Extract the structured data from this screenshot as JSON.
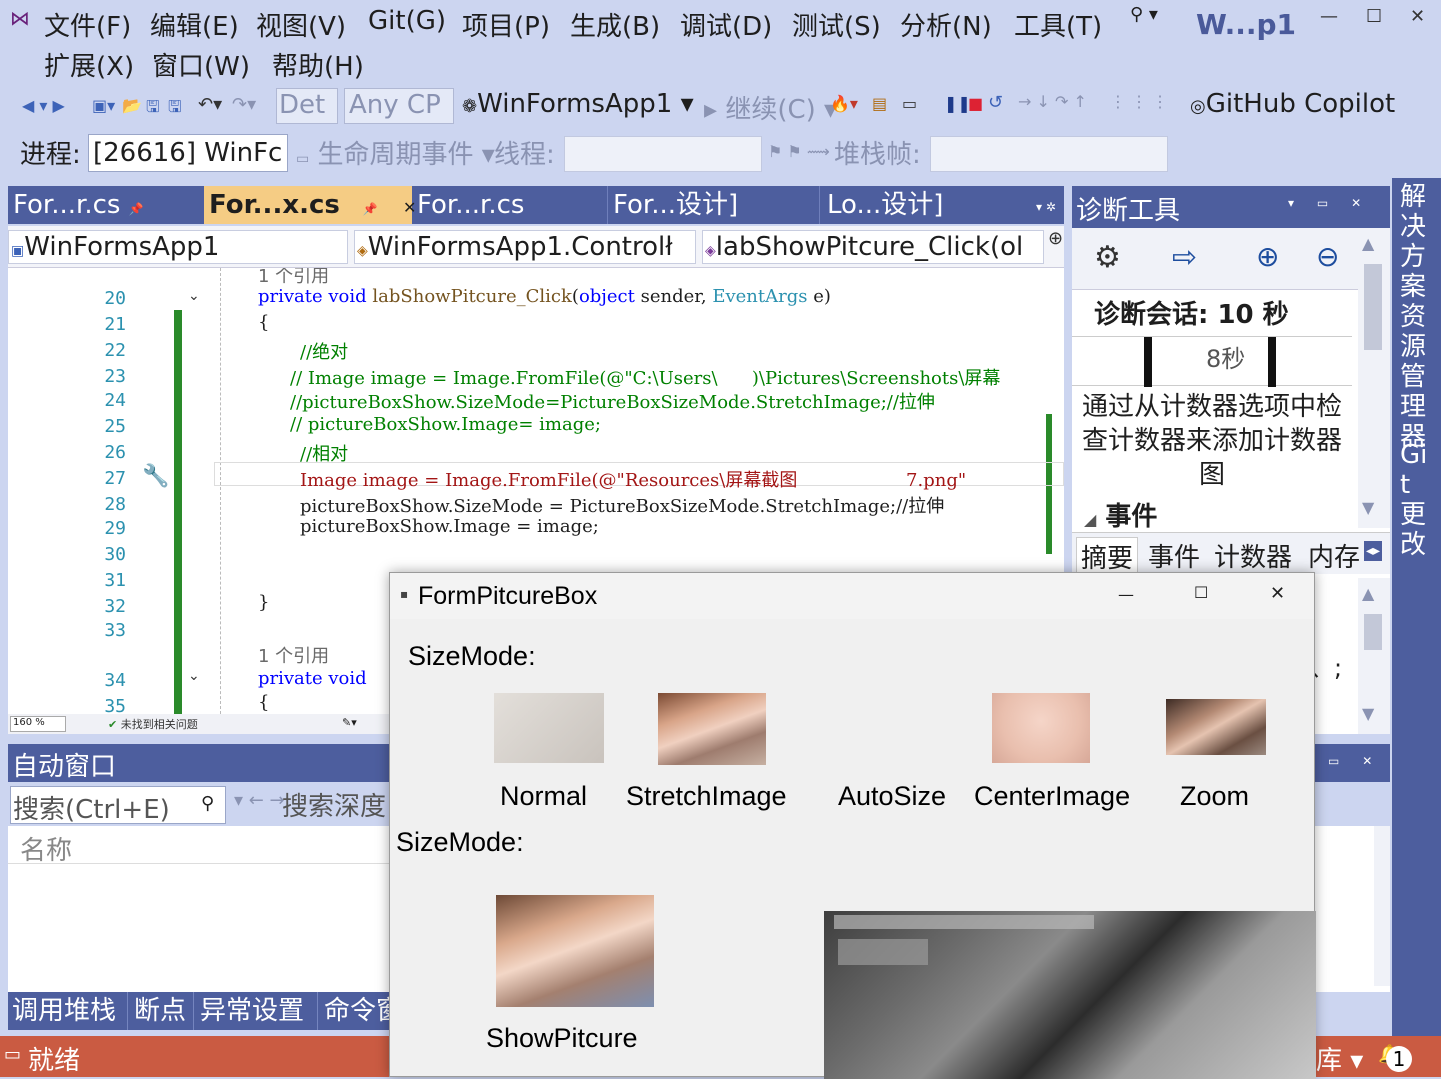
{
  "menu": {
    "items": [
      "文件(F)",
      "编辑(E)",
      "视图(V)",
      "Git(G)",
      "项目(P)",
      "生成(B)",
      "调试(D)",
      "测试(S)",
      "分析(N)",
      "工具(T)"
    ],
    "row2": [
      "扩展(X)",
      "窗口(W)",
      "帮助(H)"
    ],
    "window_title": "W...p1"
  },
  "toolbar": {
    "config": "Det",
    "platform": "Any CP",
    "startup_project": "WinFormsApp1",
    "continue": "继续(C)",
    "copilot": "GitHub Copilot"
  },
  "process": {
    "label": "进程:",
    "value": "[26616] WinFc",
    "lifecycle": "生命周期事件",
    "thread_label": "线程:",
    "stack_label": "堆栈帧:"
  },
  "doc_tabs": [
    {
      "label": "For...r.cs",
      "active": false
    },
    {
      "label": "For...x.cs",
      "active": true
    },
    {
      "label": "For...r.cs",
      "active": false
    },
    {
      "label": "For...设计]",
      "active": false
    },
    {
      "label": "Lo...设计]",
      "active": false
    }
  ],
  "navbar": {
    "project": "WinFormsApp1",
    "class": "WinFormsApp1.Controlł",
    "member": "labShowPitcure_Click(ol"
  },
  "editor": {
    "ref_count_top": "1 个引用",
    "ref_count_2": "1 个引用",
    "zoom": "160 %",
    "issues": "未找到相关问题",
    "lines": [
      {
        "n": "20",
        "html": "private void labShowPitcure_Click(object sender, EventArgs e)"
      },
      {
        "n": "21",
        "text": "{"
      },
      {
        "n": "22",
        "text": "//绝对"
      },
      {
        "n": "23",
        "text": "// Image image = Image.FromFile(@\"C:\\Users\\      )\\Pictures\\Screenshots\\屏幕"
      },
      {
        "n": "24",
        "text": "//pictureBoxShow.SizeMode=PictureBoxSizeMode.StretchImage;//拉伸"
      },
      {
        "n": "25",
        "text": "// pictureBoxShow.Image= image;"
      },
      {
        "n": "26",
        "text": "//相对"
      },
      {
        "n": "27",
        "text": "Image image = Image.FromFile(@\"Resources\\屏幕截图                   7.png\""
      },
      {
        "n": "28",
        "text": "pictureBoxShow.SizeMode = PictureBoxSizeMode.StretchImage;//拉伸"
      },
      {
        "n": "29",
        "text": "pictureBoxShow.Image = image;"
      },
      {
        "n": "30",
        "text": ""
      },
      {
        "n": "31",
        "text": ""
      },
      {
        "n": "32",
        "text": "}"
      },
      {
        "n": "33",
        "text": ""
      },
      {
        "n": "34",
        "text": "private void"
      },
      {
        "n": "35",
        "text": "{"
      }
    ]
  },
  "auto_window": {
    "title": "自动窗口",
    "search_placeholder": "搜索(Ctrl+E)",
    "search_depth": "搜索深度",
    "col_name": "名称"
  },
  "bottom_tabs": [
    "调用堆栈",
    "断点",
    "异常设置",
    "命令窗"
  ],
  "status": {
    "ready": "就绪",
    "right_text": "库",
    "notif_count": "1"
  },
  "diag": {
    "title": "诊断工具",
    "session": "诊断会话: 10 秒",
    "timeline_label": "8秒",
    "hint": "通过从计数器选项中检查计数器来添加计数器图",
    "events_header": "事件",
    "tabs": [
      "摘要",
      "事件",
      "计数器",
      "内存"
    ],
    "partial_text": "、;"
  },
  "vstrip": {
    "explorer": "解决方案资源管理器",
    "git": "Git 更改"
  },
  "form": {
    "title": "FormPitcureBox",
    "sizemode1": "SizeMode:",
    "sizemode2": "SizeMode:",
    "labels": [
      "Normal",
      "StretchImage",
      "AutoSize",
      "CenterImage",
      "Zoom"
    ],
    "show_label": "ShowPitcure"
  }
}
